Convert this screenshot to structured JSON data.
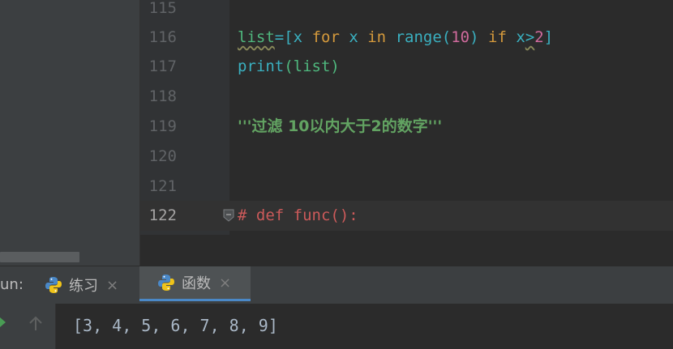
{
  "editor": {
    "line_numbers": [
      "115",
      "116",
      "117",
      "118",
      "119",
      "120",
      "121",
      "122"
    ],
    "current_line": "122",
    "line116": {
      "t1": "list",
      "t2": "=",
      "t3": "[",
      "t4": "x ",
      "t5": "for",
      "t6": " x ",
      "t7": "in",
      "t8": " ",
      "t9": "range",
      "t10": "(",
      "t11": "10",
      "t12": ")",
      "t13": " ",
      "t14": "if",
      "t15": " ",
      "t16": "x",
      "t17": ">",
      "t18": "2",
      "t19": "]"
    },
    "line117": {
      "t1": "print",
      "t2": "(list)"
    },
    "line119": {
      "t1": "'''",
      "t2": "过滤 10以内大于2的数字",
      "t3": "'''"
    },
    "line122": {
      "t1": "# def func():"
    }
  },
  "run": {
    "label": "un:",
    "tabs": [
      {
        "label": "练习",
        "icon": "python-icon"
      },
      {
        "label": "函数",
        "icon": "python-icon",
        "active": true
      }
    ],
    "close_glyph": "×"
  },
  "console": {
    "output": "[3, 4, 5, 6, 7, 8, 9]"
  },
  "colors": {
    "accent": "#4a88c7",
    "run_green": "#499c54"
  }
}
